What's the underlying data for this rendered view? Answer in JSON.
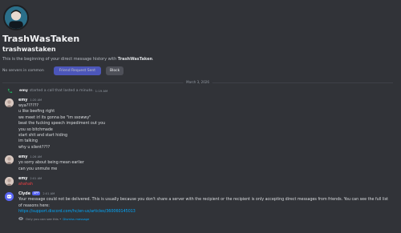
{
  "profile": {
    "display_name": "TrashWasTaken",
    "username": "trashwastaken",
    "intro_prefix": "This is the beginning of your direct message history with ",
    "intro_name": "TrashWasTaken",
    "intro_suffix": ".",
    "servers_common": "No servers in common",
    "friend_request_label": "Friend Request Sent",
    "block_label": "Block"
  },
  "date_divider": "March 3, 2026",
  "call_event": {
    "name": "emy",
    "text": "started a call that lasted a minute.",
    "time": "1:19 AM"
  },
  "messages": [
    {
      "author": "emy",
      "time": "1:20 AM",
      "lines": [
        "wya??????",
        "u like beefing right",
        "we meet irl its gonna be \"im ssowwy\"",
        "beat the fucking speech impediment out you",
        "you so bitchmade",
        "start shit and start hiding",
        "im talking",
        "why u silent????"
      ]
    },
    {
      "author": "emy",
      "time": "1:26 AM",
      "lines": [
        "yo sorry about being mean earlier",
        "can you unmute me"
      ]
    },
    {
      "author": "emy",
      "time": "2:01 AM",
      "lines": [
        "ahahah"
      ],
      "failed": true
    }
  ],
  "clyde": {
    "name": "Clyde",
    "tag": "APP",
    "time": "2:01 AM",
    "text": "Your message could not be delivered. This is usually because you don't share a server with the recipient or the recipient is only accepting direct messages from friends. You can see the full list of reasons here:",
    "link": "https://support.discord.com/hc/en-us/articles/360060145013",
    "only_you": "Only you can see this •",
    "dismiss": "Dismiss message"
  },
  "colors": {
    "background": "#313338",
    "accent": "#5865f2",
    "error": "#f23f43",
    "link": "#00a8fc",
    "call_icon": "#23a55a"
  },
  "icons": {
    "call": "phone-icon",
    "visibility": "eye-icon"
  }
}
